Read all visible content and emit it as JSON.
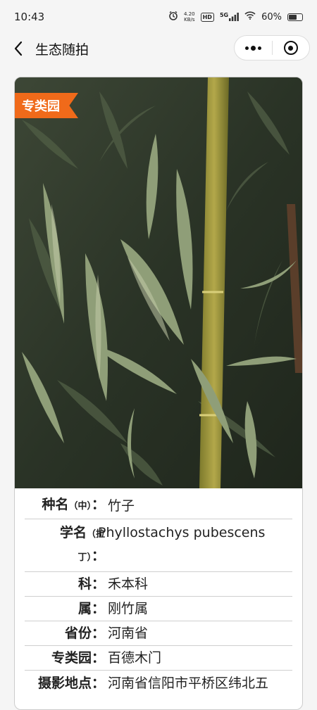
{
  "status_bar": {
    "time": "10:43",
    "net_speed_value": "4.20",
    "net_speed_unit": "KB/s",
    "hd_badge": "HD",
    "signal_badge": "5G",
    "battery_text": "60%",
    "icons": [
      "alarm-icon",
      "hd-icon",
      "5g-signal-icon",
      "wifi-icon",
      "battery-icon"
    ]
  },
  "nav": {
    "title": "生态随拍",
    "back_icon": "chevron-left-icon",
    "more_icon": "more-dots-icon",
    "close_icon": "target-circle-icon"
  },
  "card": {
    "badge": "专类园",
    "photo_subject": "bamboo",
    "rows": [
      {
        "label_main": "种名",
        "label_sub": "（中）",
        "colon": "：",
        "value": "竹子"
      },
      {
        "label_main": "学名",
        "label_sub": "（拉",
        "label_sub2": "丁）",
        "colon": "：",
        "value": "Phyllostachys pubescens"
      },
      {
        "label_main": "科",
        "label_sub": "",
        "colon": "：",
        "value": "禾本科"
      },
      {
        "label_main": "属",
        "label_sub": "",
        "colon": "：",
        "value": "刚竹属"
      },
      {
        "label_main": "省份",
        "label_sub": "",
        "colon": "：",
        "value": "河南省"
      },
      {
        "label_main": "专类园",
        "label_sub": "",
        "colon": "：",
        "value": "百德木门"
      },
      {
        "label_main": "摄影地点",
        "label_sub": "",
        "colon": "：",
        "value": "河南省信阳市平桥区纬北五"
      }
    ]
  },
  "colors": {
    "badge_bg": "#f06a1a",
    "page_bg": "#f5f5f5",
    "divider": "#cfcfcf"
  }
}
